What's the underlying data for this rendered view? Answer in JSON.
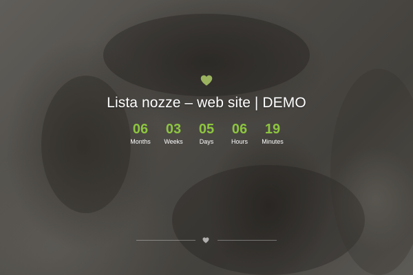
{
  "title": "Lista nozze – web site | DEMO",
  "colors": {
    "accent": "#8dc63f",
    "heart": "#9bb35e",
    "text": "#ffffff"
  },
  "icons": {
    "top": "heart-icon",
    "divider": "heart-icon"
  },
  "countdown": [
    {
      "value": "06",
      "label": "Months"
    },
    {
      "value": "03",
      "label": "Weeks"
    },
    {
      "value": "05",
      "label": "Days"
    },
    {
      "value": "06",
      "label": "Hours"
    },
    {
      "value": "19",
      "label": "Minutes"
    }
  ]
}
